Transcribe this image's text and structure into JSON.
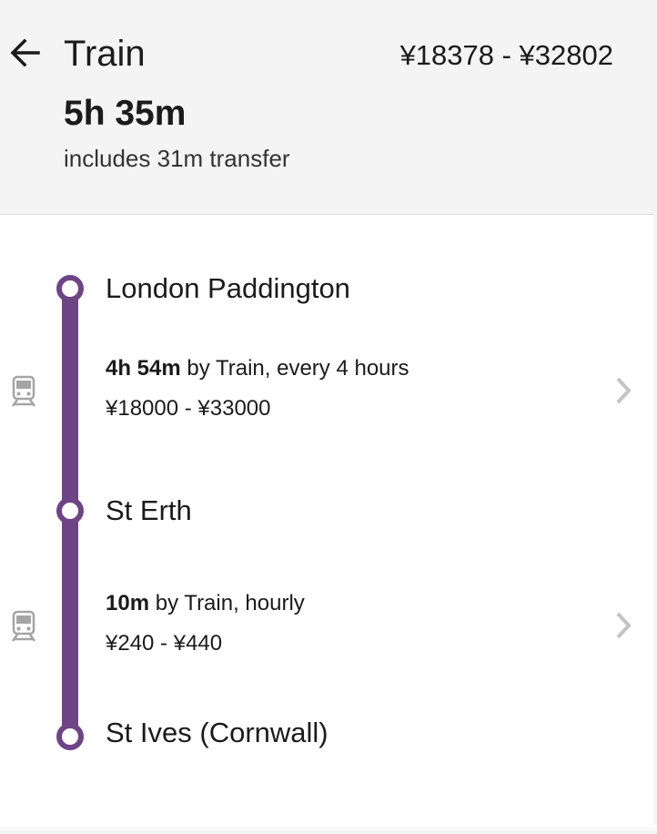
{
  "header": {
    "back_icon": "arrow-left-icon",
    "title": "Train",
    "price_range": "¥18378 - ¥32802",
    "duration": "5h 35m",
    "transfer_note": "includes 31m transfer"
  },
  "route": {
    "line_color": "#6f4487",
    "stops": [
      {
        "name": "London Paddington"
      },
      {
        "name": "St Erth"
      },
      {
        "name": "St Ives (Cornwall)"
      }
    ],
    "legs": [
      {
        "icon": "train-icon",
        "duration": "4h 54m",
        "description": " by Train, every 4 hours",
        "price": "¥18000 - ¥33000"
      },
      {
        "icon": "train-icon",
        "duration": "10m",
        "description": " by Train, hourly",
        "price": "¥240 - ¥440"
      }
    ]
  }
}
